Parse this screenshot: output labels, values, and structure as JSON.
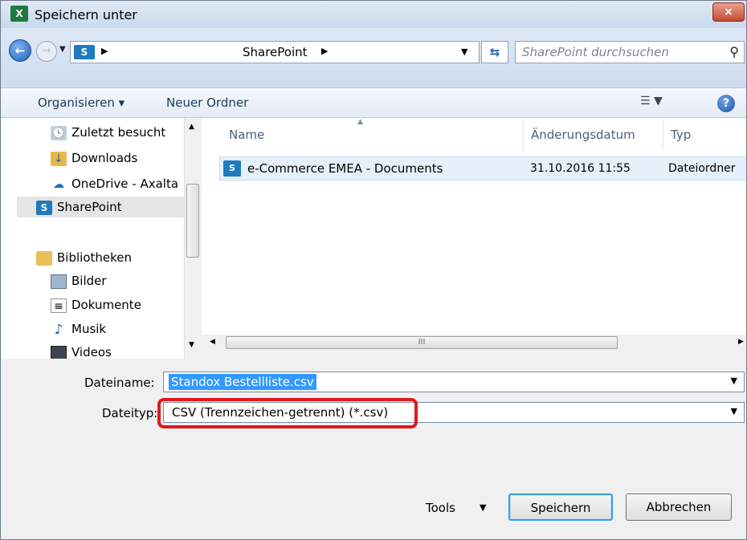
{
  "window": {
    "title": "Speichern unter",
    "app_icon": "excel-icon",
    "close_label": "×"
  },
  "address_bar": {
    "location": "SharePoint",
    "location_badge": "S",
    "search_placeholder": "SharePoint durchsuchen"
  },
  "toolbar": {
    "organize_label": "Organisieren ▾",
    "new_folder_label": "Neuer Ordner"
  },
  "nav_pane": {
    "items": [
      {
        "label": "Zuletzt besucht",
        "icon": "recent-places-icon"
      },
      {
        "label": "Downloads",
        "icon": "downloads-folder-icon"
      },
      {
        "label": "OneDrive - Axalta",
        "icon": "onedrive-icon"
      },
      {
        "label": "SharePoint",
        "icon": "sharepoint-icon",
        "selected": true
      },
      {
        "label": "Bibliotheken",
        "icon": "libraries-folder-icon"
      },
      {
        "label": "Bilder",
        "icon": "pictures-icon"
      },
      {
        "label": "Dokumente",
        "icon": "documents-icon"
      },
      {
        "label": "Musik",
        "icon": "music-icon"
      },
      {
        "label": "Videos",
        "icon": "videos-icon"
      }
    ]
  },
  "file_list": {
    "columns": [
      "Name",
      "Änderungsdatum",
      "Typ"
    ],
    "rows": [
      {
        "name": "e-Commerce EMEA - Documents",
        "modified": "31.10.2016 11:55",
        "type": "Dateiordner"
      }
    ],
    "scroll_grip": "III"
  },
  "form": {
    "filename_label": "Dateiname:",
    "filename_value": "Standox Bestellliste.csv",
    "filetype_label": "Dateityp:",
    "filetype_value": "CSV (Trennzeichen-getrennt) (*.csv)"
  },
  "buttons": {
    "tools_label": "Tools",
    "save_label": "Speichern",
    "cancel_label": "Abbrechen"
  },
  "colors": {
    "selection": "#3399ff",
    "highlight_border": "#e3181e",
    "excel_green": "#1d7a3f",
    "sharepoint_blue": "#1f7abf"
  }
}
